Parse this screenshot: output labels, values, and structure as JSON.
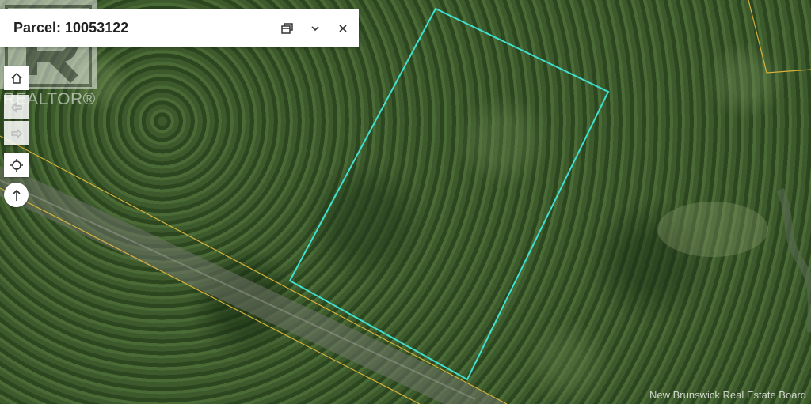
{
  "popup": {
    "title": "Parcel: 10053122",
    "dock_label": "Dock",
    "collapse_label": "Collapse",
    "close_label": "Close"
  },
  "logo": {
    "wordmark": "REALTOR®"
  },
  "toolbar": {
    "home_icon": "home-icon",
    "back_icon": "back-arrow-icon",
    "forward_icon": "forward-arrow-icon",
    "locate_icon": "crosshair-icon",
    "north_icon": "north-arrow-icon"
  },
  "map": {
    "parcel_outline_color": "#3fe0d0",
    "property_line_color": "#d8b13a",
    "road_color": "#8a8f86"
  },
  "credit": "New Brunswick Real Estate Board"
}
